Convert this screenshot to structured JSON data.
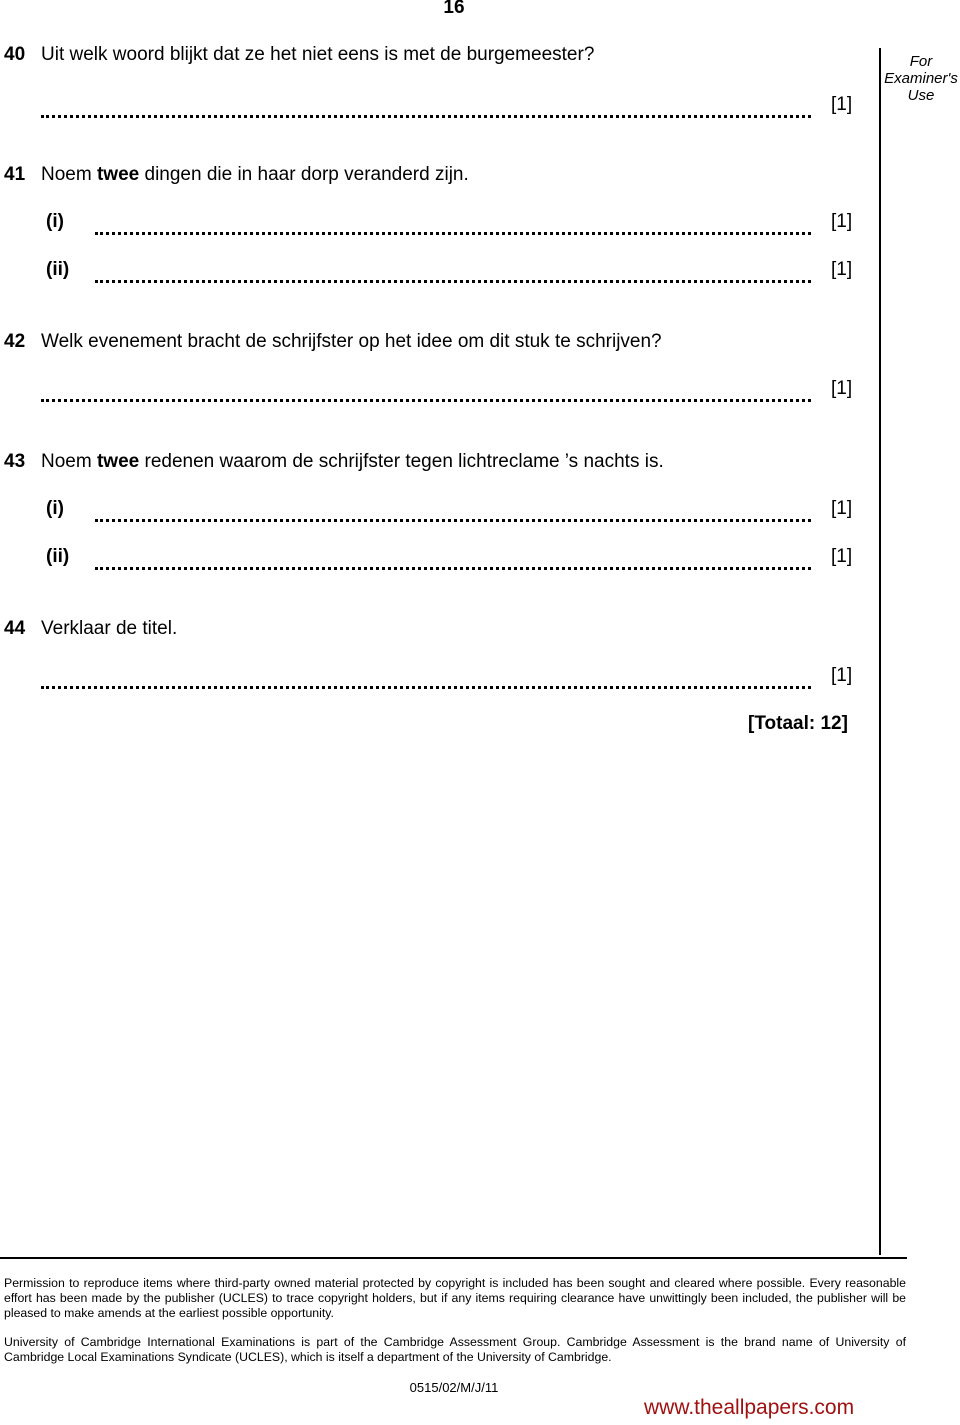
{
  "page": {
    "number": "16",
    "examiner_label": [
      "For",
      "Examiner's",
      "Use"
    ]
  },
  "questions": [
    {
      "number": "40",
      "text": "Uit welk woord blijkt dat ze het niet eens is met de burgemeester?",
      "answers": [
        {
          "label": "",
          "mark": "[1]"
        }
      ]
    },
    {
      "number": "41",
      "text_before": "Noem ",
      "text_bold": "twee",
      "text_after": " dingen die in haar dorp veranderd zijn.",
      "answers": [
        {
          "label": "(i)",
          "mark": "[1]"
        },
        {
          "label": "(ii)",
          "mark": "[1]"
        }
      ]
    },
    {
      "number": "42",
      "text": "Welk evenement bracht de schrijfster op het idee om dit stuk te schrijven?",
      "answers": [
        {
          "label": "",
          "mark": "[1]"
        }
      ]
    },
    {
      "number": "43",
      "text_before": "Noem ",
      "text_bold": "twee",
      "text_after": " redenen waarom de schrijfster tegen lichtreclame ’s nachts is.",
      "answers": [
        {
          "label": "(i)",
          "mark": "[1]"
        },
        {
          "label": "(ii)",
          "mark": "[1]"
        }
      ]
    },
    {
      "number": "44",
      "text": "Verklaar de titel.",
      "answers": [
        {
          "label": "",
          "mark": "[1]"
        }
      ]
    }
  ],
  "total": "[Totaal: 12]",
  "footer": {
    "permission": "Permission to reproduce items where third-party owned material protected by copyright is included has been sought and cleared where possible. Every reasonable effort has been made by the publisher (UCLES) to trace copyright holders, but if any items requiring clearance have unwittingly been included, the publisher will be pleased to make amends at the earliest possible opportunity.",
    "ucles": "University of Cambridge International Examinations is part of the Cambridge Assessment Group. Cambridge Assessment is the brand name of University of Cambridge Local Examinations Syndicate (UCLES), which is itself a department of the University of Cambridge.",
    "exam_code": "0515/02/M/J/11",
    "site_link": "www.theallpapers.com",
    "site_link_color": "#a01010"
  }
}
